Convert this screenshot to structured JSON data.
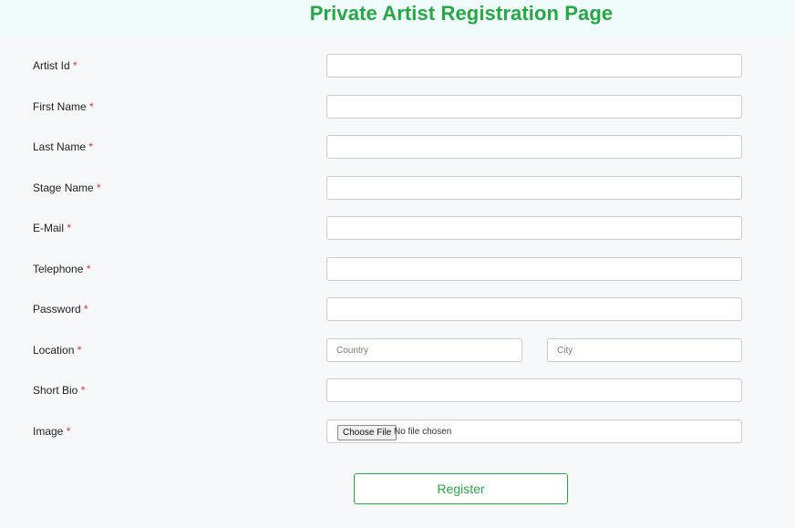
{
  "page": {
    "title": "Private Artist Registration Page"
  },
  "form": {
    "required_marker": "*",
    "fields": [
      {
        "label": "Artist Id",
        "value": ""
      },
      {
        "label": "First Name",
        "value": ""
      },
      {
        "label": "Last Name",
        "value": ""
      },
      {
        "label": "Stage Name",
        "value": ""
      },
      {
        "label": "E-Mail",
        "value": ""
      },
      {
        "label": "Telephone",
        "value": ""
      },
      {
        "label": "Password",
        "value": ""
      },
      {
        "label": "Location",
        "country_placeholder": "Country",
        "city_placeholder": "City",
        "country_value": "",
        "city_value": ""
      },
      {
        "label": "Short Bio",
        "value": ""
      },
      {
        "label": "Image",
        "button_label": "Choose File",
        "status": "No file chosen"
      }
    ],
    "submit_label": "Register"
  },
  "colors": {
    "accent": "#28a745",
    "required": "#dc3545",
    "header_background": "#effcfb"
  }
}
